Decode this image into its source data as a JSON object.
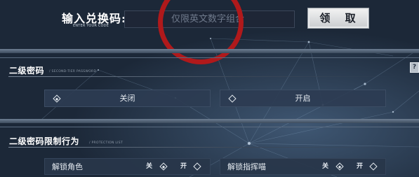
{
  "redeem": {
    "title": "输入兑换码:",
    "subtitle": "ENTER YOUR CODE",
    "input_placeholder": "仅限英文数字组合",
    "button_label": "领 取"
  },
  "second_password": {
    "title": "二级密码",
    "subtitle": "/ SECOND-TIER PASSWORD",
    "options": [
      "关闭",
      "开启"
    ],
    "selected": "关闭"
  },
  "restriction": {
    "title": "二级密码限制行为",
    "subtitle": "/ PROTECTION LIST",
    "items": [
      {
        "label": "解锁角色",
        "off_label": "关",
        "on_label": "开",
        "value": "关"
      },
      {
        "label": "解锁指挥喵",
        "off_label": "关",
        "on_label": "开",
        "value": "关"
      }
    ]
  },
  "corner_icon": "help-icon",
  "colors": {
    "background": "#1c2838",
    "annotation_circle": "#b0191b",
    "button_bg": "#dfe1e3"
  }
}
